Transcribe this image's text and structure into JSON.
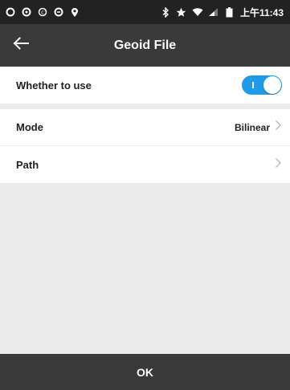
{
  "status_bar": {
    "icons_left": [
      "notification-icon-1",
      "notification-icon-2",
      "notification-icon-3",
      "notification-icon-4",
      "location-pin-icon"
    ],
    "icons_right": [
      "bluetooth-icon",
      "star-icon",
      "wifi-icon",
      "signal-icon",
      "battery-icon"
    ],
    "time": "上午11:43"
  },
  "app_bar": {
    "title": "Geoid File",
    "back_icon": "arrow-left-icon"
  },
  "settings": {
    "whether_to_use": {
      "label": "Whether to use",
      "enabled": true
    },
    "mode": {
      "label": "Mode",
      "value": "Bilinear"
    },
    "path": {
      "label": "Path",
      "value": ""
    }
  },
  "footer": {
    "ok_label": "OK"
  },
  "colors": {
    "toolbar": "#3a3a3a",
    "status_bar": "#222222",
    "toggle_on": "#1e9be8",
    "background": "#ececec"
  }
}
